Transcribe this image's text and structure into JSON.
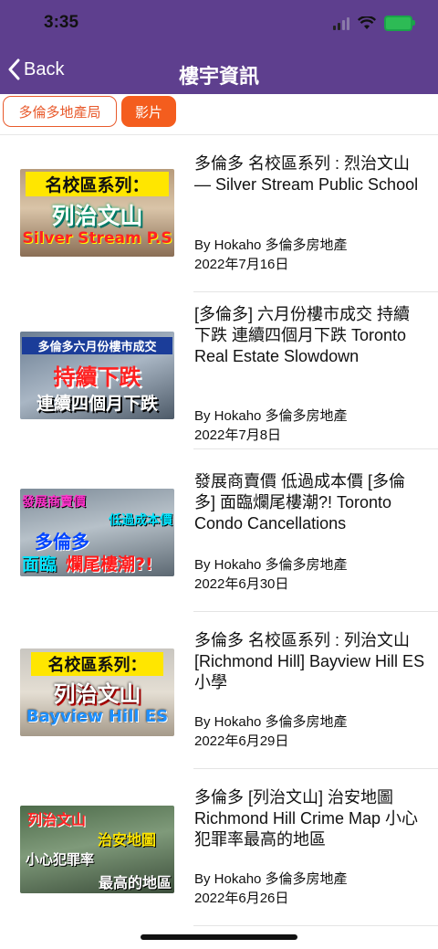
{
  "status_bar": {
    "time": "3:35"
  },
  "nav": {
    "back_label": "Back",
    "title": "樓宇資訊"
  },
  "tabs": [
    {
      "label": "多倫多地產局",
      "active": false
    },
    {
      "label": "影片",
      "active": true
    }
  ],
  "videos": [
    {
      "title": "多倫多 名校區系列 : 烈治文山 — Silver Stream Public School",
      "author": "By Hokaho 多倫多房地產",
      "date": "2022年7月16日",
      "thumb_lines": [
        "名校區系列：",
        "列治文山",
        "Silver Stream P.S"
      ]
    },
    {
      "title": "[多倫多] 六月份樓市成交 持續下跌 連續四個月下跌 Toronto Real Estate Slowdown",
      "author": "By Hokaho 多倫多房地產",
      "date": "2022年7月8日",
      "thumb_lines": [
        "多倫多六月份樓市成交",
        "持續下跌",
        "連續四個月下跌"
      ]
    },
    {
      "title": "發展商賣價 低過成本價 [多倫多] 面臨爛尾樓潮?! Toronto Condo Cancellations",
      "author": "By Hokaho 多倫多房地產",
      "date": "2022年6月30日",
      "thumb_lines": [
        "發展商賣價",
        "低過成本價",
        "多倫多",
        "面臨",
        "爛尾樓潮?!"
      ]
    },
    {
      "title": "多倫多 名校區系列 : 列治文山 [Richmond Hill] Bayview Hill ES 小學",
      "author": "By Hokaho 多倫多房地產",
      "date": "2022年6月29日",
      "thumb_lines": [
        "名校區系列：",
        "列治文山",
        "Bayview Hill ES"
      ]
    },
    {
      "title": "多倫多 [列治文山] 治安地圖 Richmond Hill Crime Map 小心犯罪率最高的地區",
      "author": "By Hokaho 多倫多房地產",
      "date": "2022年6月26日",
      "thumb_lines": [
        "列治文山",
        "治安地圖",
        "小心犯罪率",
        "最高的地區"
      ]
    }
  ],
  "colors": {
    "header": "#5e3f8e",
    "tab_accent": "#f45d1e"
  }
}
